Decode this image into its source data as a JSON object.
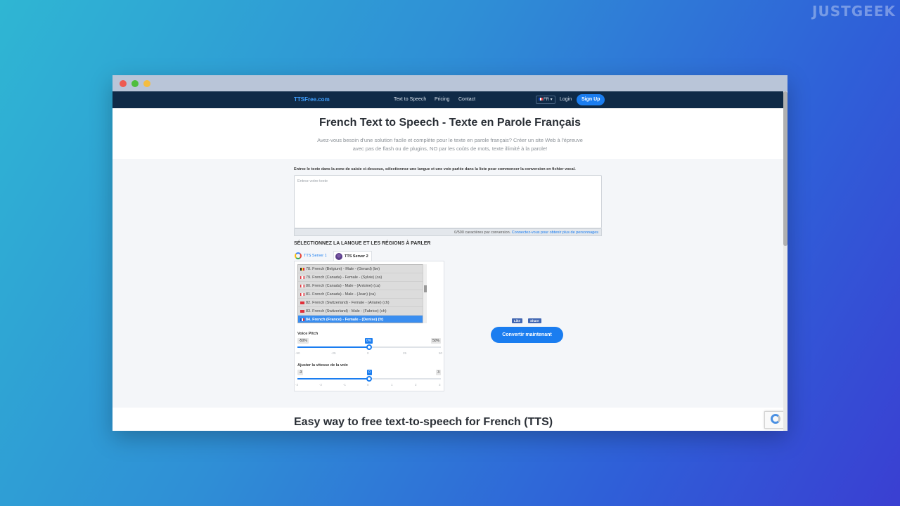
{
  "watermark": "JUSTGEEK",
  "nav": {
    "brand": "TTSFree.com",
    "links": [
      "Text to Speech",
      "Pricing",
      "Contact"
    ],
    "lang": "FR",
    "login": "Login",
    "signup": "Sign Up"
  },
  "hero": {
    "title": "French Text to Speech - Texte en Parole Français",
    "subtitle": "Avez-vous besoin d'une solution facile et complète pour le texte en parole français? Créer un site Web à l'épreuve avec pas de flash ou de plugins, NO par les coûts de mots, texte illimité à la parole!"
  },
  "form": {
    "instructions": "Entrez le texte dans la zone de saisie ci-dessous, sélectionnez une langue et une voix parlée dans la liste pour commencer la conversion en fichier vocal.",
    "placeholder": "Entrez votre texte",
    "char_count": "0/500 caractères par conversion.",
    "char_link": "Connectez-vous pour obtenir plus de personnages",
    "section_title": "SÉLECTIONNEZ LA LANGUE ET LES RÉGIONS À PARLER",
    "tab1": "TTS Server 1",
    "tab2": "TTS Server 2"
  },
  "voices": [
    {
      "flag": "be",
      "label": "78. French (Belgium) - Male - (Gerard) (be)"
    },
    {
      "flag": "ca",
      "label": "79. French (Canada) - Female - (Sylvie) (ca)"
    },
    {
      "flag": "ca",
      "label": "80. French (Canada) - Male - (Antoine) (ca)"
    },
    {
      "flag": "ca",
      "label": "81. French (Canada) - Male - (Jean) (ca)"
    },
    {
      "flag": "ch",
      "label": "82. French (Switzerland) - Female - (Ariane) (ch)"
    },
    {
      "flag": "ch",
      "label": "83. French (Switzerland) - Male - (Fabrice) (ch)"
    },
    {
      "flag": "fr",
      "label": "84. French (France) - Female - (Denise) (fr)",
      "selected": true
    }
  ],
  "pitch": {
    "label": "Voice Pitch",
    "min": "-50%",
    "max": "50%",
    "value": "0%",
    "value_fraction": 0.5,
    "ticks": [
      "-50",
      "-25",
      "0",
      "25",
      "50"
    ]
  },
  "speed": {
    "label": "Ajuster la vitesse de la voix",
    "min": "-3",
    "max": "3",
    "value": "0",
    "value_fraction": 0.5,
    "ticks": [
      "-3",
      "-2",
      "-1",
      "0",
      "1",
      "2",
      "3"
    ]
  },
  "social": {
    "like": "Like",
    "share": "Share"
  },
  "convert_label": "Convertir maintenant",
  "bottom_title": "Easy way to free text-to-speech for French (TTS)"
}
